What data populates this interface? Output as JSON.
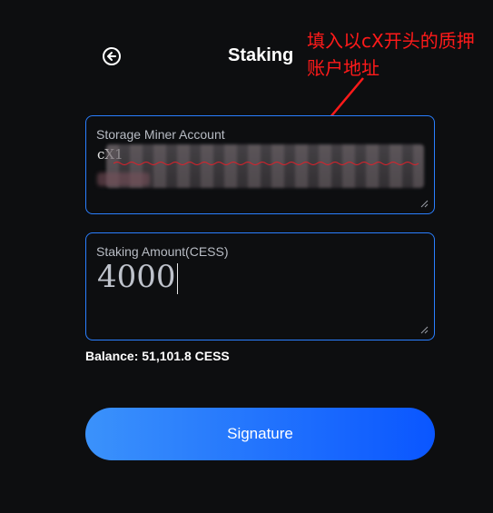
{
  "header": {
    "back_icon": "arrow-left-circle-icon",
    "title": "Staking"
  },
  "annotation": {
    "text": "填入以cX开头的质押账户地址",
    "color": "#ff1a1a"
  },
  "form": {
    "account": {
      "label": "Storage Miner Account",
      "value": "cX1"
    },
    "amount": {
      "label": "Staking Amount(CESS)",
      "value": "4000"
    },
    "balance": "Balance: 51,101.8 CESS"
  },
  "actions": {
    "submit_label": "Signature"
  },
  "colors": {
    "background": "#0d0e10",
    "field_border": "#2a7fff",
    "button_gradient_start": "#3b92fb",
    "button_gradient_end": "#0a56ff"
  }
}
